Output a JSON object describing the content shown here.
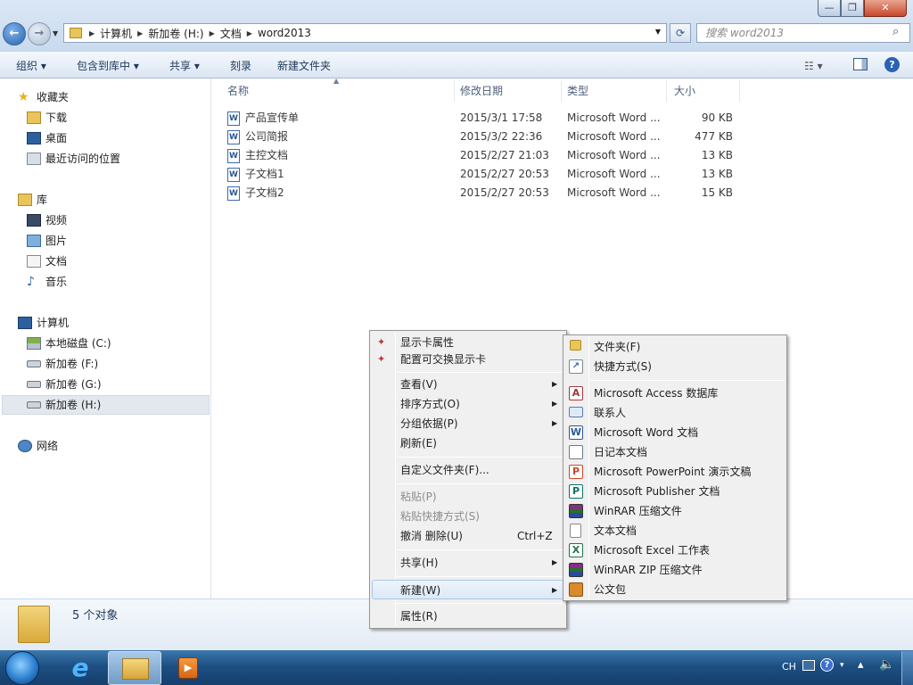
{
  "window": {
    "minimize": "—",
    "maximize": "❐",
    "close": "✕"
  },
  "address": {
    "crumbs": [
      "计算机",
      "新加卷 (H:)",
      "文档",
      "word2013"
    ]
  },
  "search": {
    "placeholder": "搜索 word2013"
  },
  "toolbar": {
    "organize": "组织",
    "include": "包含到库中",
    "share": "共享",
    "burn": "刻录",
    "new_folder": "新建文件夹"
  },
  "sidebar": {
    "favorites": {
      "label": "收藏夹",
      "items": [
        "下载",
        "桌面",
        "最近访问的位置"
      ]
    },
    "libraries": {
      "label": "库",
      "items": [
        "视频",
        "图片",
        "文档",
        "音乐"
      ]
    },
    "computer": {
      "label": "计算机",
      "items": [
        "本地磁盘 (C:)",
        "新加卷 (F:)",
        "新加卷 (G:)",
        "新加卷 (H:)"
      ]
    },
    "network": "网络"
  },
  "columns": {
    "name": "名称",
    "modified": "修改日期",
    "type": "类型",
    "size": "大小"
  },
  "files": [
    {
      "name": "产品宣传单",
      "modified": "2015/3/1 17:58",
      "type": "Microsoft Word ...",
      "size": "90 KB"
    },
    {
      "name": "公司简报",
      "modified": "2015/3/2 22:36",
      "type": "Microsoft Word ...",
      "size": "477 KB"
    },
    {
      "name": "主控文档",
      "modified": "2015/2/27 21:03",
      "type": "Microsoft Word ...",
      "size": "13 KB"
    },
    {
      "name": "子文档1",
      "modified": "2015/2/27 20:53",
      "type": "Microsoft Word ...",
      "size": "13 KB"
    },
    {
      "name": "子文档2",
      "modified": "2015/2/27 20:53",
      "type": "Microsoft Word ...",
      "size": "15 KB"
    }
  ],
  "status": {
    "count": "5 个对象"
  },
  "context_menu": {
    "display_props": "显示卡属性",
    "switchable": "配置可交换显示卡",
    "view": "查看(V)",
    "sort": "排序方式(O)",
    "group": "分组依据(P)",
    "refresh": "刷新(E)",
    "customize": "自定义文件夹(F)...",
    "paste": "粘贴(P)",
    "paste_shortcut": "粘贴快捷方式(S)",
    "undo": "撤消 删除(U)",
    "undo_key": "Ctrl+Z",
    "share": "共享(H)",
    "new": "新建(W)",
    "properties": "属性(R)"
  },
  "submenu": {
    "folder": "文件夹(F)",
    "shortcut": "快捷方式(S)",
    "access": "Microsoft Access 数据库",
    "contact": "联系人",
    "word": "Microsoft Word 文档",
    "journal": "日记本文档",
    "powerpoint": "Microsoft PowerPoint 演示文稿",
    "publisher": "Microsoft Publisher 文档",
    "winrar": "WinRAR 压缩文件",
    "text": "文本文档",
    "excel": "Microsoft Excel 工作表",
    "winrar_zip": "WinRAR ZIP 压缩文件",
    "briefcase": "公文包"
  },
  "tray": {
    "lang": "CH"
  }
}
